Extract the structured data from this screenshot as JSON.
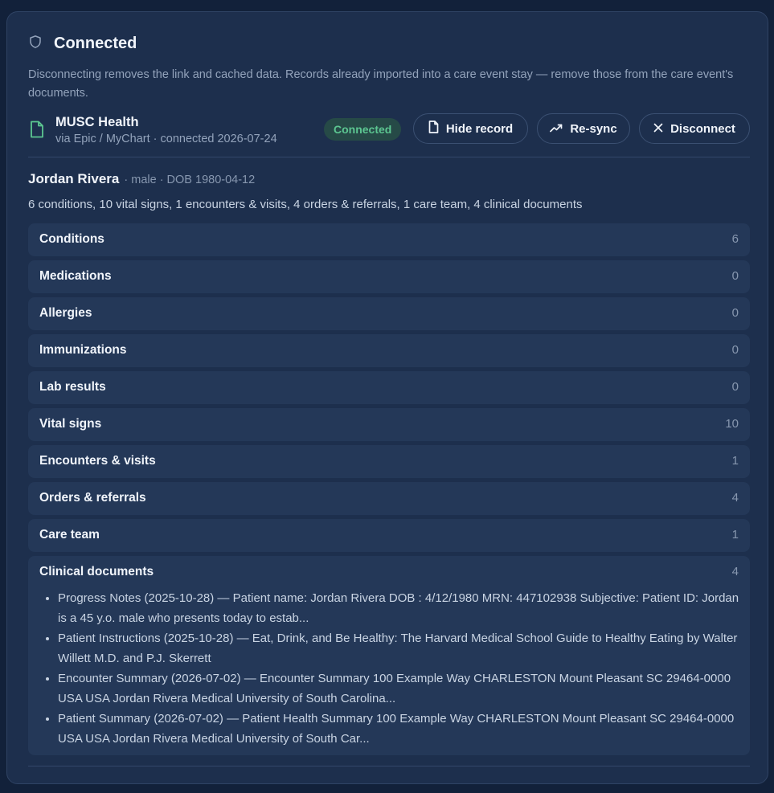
{
  "header": {
    "title": "Connected",
    "description": "Disconnecting removes the link and cached data. Records already imported into a care event stay — remove those from the care event's documents."
  },
  "source": {
    "name": "MUSC Health",
    "subtitle": "via Epic / MyChart · connected 2026-07-24",
    "status": "Connected"
  },
  "actions": {
    "hide_record": "Hide record",
    "resync": "Re-sync",
    "disconnect": "Disconnect"
  },
  "patient": {
    "name": "Jordan Rivera",
    "meta": "· male · DOB 1980-04-12",
    "summary": "6 conditions, 10 vital signs, 1 encounters & visits, 4 orders & referrals, 1 care team, 4 clinical documents"
  },
  "sections": [
    {
      "label": "Conditions",
      "count": "6"
    },
    {
      "label": "Medications",
      "count": "0"
    },
    {
      "label": "Allergies",
      "count": "0"
    },
    {
      "label": "Immunizations",
      "count": "0"
    },
    {
      "label": "Lab results",
      "count": "0"
    },
    {
      "label": "Vital signs",
      "count": "10"
    },
    {
      "label": "Encounters & visits",
      "count": "1"
    },
    {
      "label": "Orders & referrals",
      "count": "4"
    },
    {
      "label": "Care team",
      "count": "1"
    },
    {
      "label": "Clinical documents",
      "count": "4"
    }
  ],
  "documents": [
    "Progress Notes (2025-10-28) — Patient name: Jordan Rivera DOB : 4/12/1980 MRN: 447102938 Subjective: Patient ID: Jordan is a 45 y.o. male who presents today to estab...",
    "Patient Instructions (2025-10-28) — Eat, Drink, and Be Healthy: The Harvard Medical School Guide to Healthy Eating by Walter Willett M.D. and P.J. Skerrett",
    "Encounter Summary (2026-07-02) — Encounter Summary 100 Example Way CHARLESTON Mount Pleasant SC 29464-0000 USA USA Jordan Rivera Medical University of South Carolina...",
    "Patient Summary (2026-07-02) — Patient Health Summary 100 Example Way CHARLESTON Mount Pleasant SC 29464-0000 USA USA Jordan Rivera Medical University of South Car..."
  ],
  "icons": {
    "header": "shield-icon",
    "source": "document-icon",
    "hide": "document-icon",
    "resync": "trend-line-icon",
    "disconnect": "close-icon"
  },
  "colors": {
    "background": "#12213a",
    "card": "#1d2f4d",
    "section": "#243858",
    "status_text": "#5cc691",
    "status_bg": "#264a47"
  }
}
